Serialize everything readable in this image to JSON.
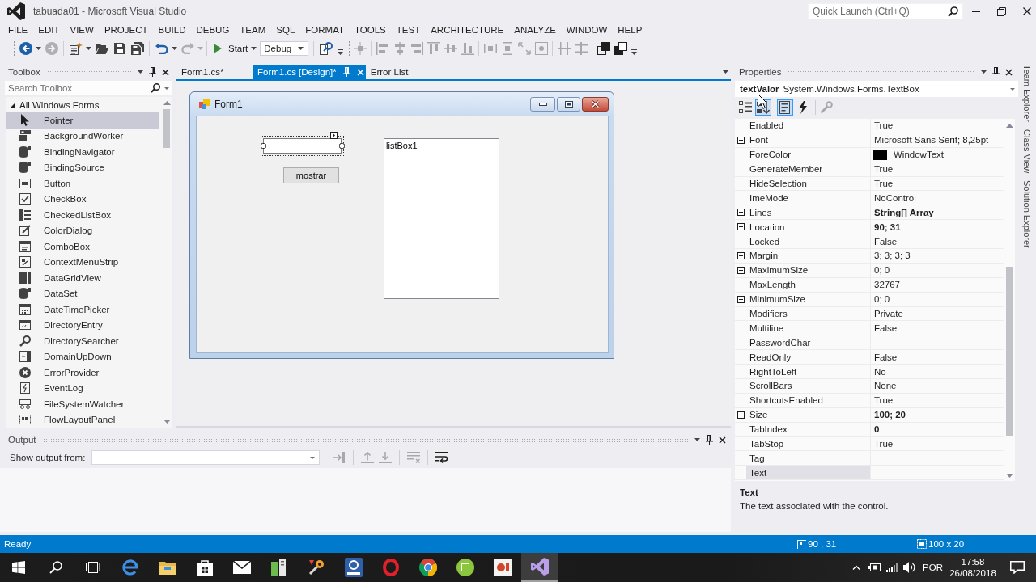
{
  "window": {
    "title": "tabuada01 - Microsoft Visual Studio",
    "quick_launch": {
      "placeholder": "Quick Launch (Ctrl+Q)"
    }
  },
  "menu": [
    "FILE",
    "EDIT",
    "VIEW",
    "PROJECT",
    "BUILD",
    "DEBUG",
    "TEAM",
    "SQL",
    "FORMAT",
    "TOOLS",
    "TEST",
    "ARCHITECTURE",
    "ANALYZE",
    "WINDOW",
    "HELP"
  ],
  "toolbars": [
    {
      "groups": [
        [
          {
            "kind": "split",
            "disabled": false
          },
          {
            "kind": "button",
            "disabled": true
          }
        ],
        [
          {
            "kind": "split",
            "disabled": false
          },
          {
            "kind": "button",
            "disabled": false
          },
          {
            "kind": "button",
            "disabled": false
          },
          {
            "kind": "button",
            "disabled": false
          }
        ],
        [
          {
            "kind": "split",
            "disabled": false
          },
          {
            "kind": "split",
            "disabled": true
          }
        ],
        [
          {
            "kind": "start",
            "label": "Start",
            "disabled": false
          },
          {
            "kind": "combo",
            "value": "Debug"
          }
        ],
        [
          {
            "kind": "button",
            "disabled": false
          }
        ]
      ]
    },
    {
      "groups": [
        [
          {
            "kind": "button",
            "disabled": true
          }
        ],
        [
          {
            "kind": "button",
            "disabled": true
          },
          {
            "kind": "button",
            "disabled": true
          },
          {
            "kind": "button",
            "disabled": true
          },
          {
            "kind": "button",
            "disabled": true
          },
          {
            "kind": "button",
            "disabled": true
          },
          {
            "kind": "button",
            "disabled": true
          }
        ],
        [
          {
            "kind": "button",
            "disabled": true
          },
          {
            "kind": "button",
            "disabled": true
          },
          {
            "kind": "button",
            "disabled": true
          },
          {
            "kind": "button",
            "disabled": true
          }
        ],
        [
          {
            "kind": "button",
            "disabled": true
          },
          {
            "kind": "button",
            "disabled": true
          }
        ],
        [
          {
            "kind": "button",
            "disabled": false
          },
          {
            "kind": "button",
            "disabled": false
          }
        ]
      ]
    }
  ],
  "toolbox": {
    "title": "Toolbox",
    "search": {
      "placeholder": "Search Toolbox"
    },
    "tree": [
      {
        "label": "All Windows Forms",
        "expanded": true,
        "children": [
          {
            "label": "Pointer",
            "selected": true
          },
          {
            "label": "BackgroundWorker",
            "selected": false
          },
          {
            "label": "BindingNavigator",
            "selected": false
          },
          {
            "label": "BindingSource",
            "selected": false
          },
          {
            "label": "Button",
            "selected": false
          },
          {
            "label": "CheckBox",
            "selected": false
          },
          {
            "label": "CheckedListBox",
            "selected": false
          },
          {
            "label": "ColorDialog",
            "selected": false
          },
          {
            "label": "ComboBox",
            "selected": false
          },
          {
            "label": "ContextMenuStrip",
            "selected": false
          },
          {
            "label": "DataGridView",
            "selected": false
          },
          {
            "label": "DataSet",
            "selected": false
          },
          {
            "label": "DateTimePicker",
            "selected": false
          },
          {
            "label": "DirectoryEntry",
            "selected": false
          },
          {
            "label": "DirectorySearcher",
            "selected": false
          },
          {
            "label": "DomainUpDown",
            "selected": false
          },
          {
            "label": "ErrorProvider",
            "selected": false
          },
          {
            "label": "EventLog",
            "selected": false
          },
          {
            "label": "FileSystemWatcher",
            "selected": false
          },
          {
            "label": "FlowLayoutPanel",
            "selected": false
          }
        ]
      }
    ]
  },
  "designer": {
    "tabs": [
      {
        "label": "Form1.cs*",
        "selected": false
      },
      {
        "label": "Form1.cs [Design]*",
        "selected": true
      },
      {
        "label": "Error List",
        "selected": false
      }
    ],
    "form": {
      "title": "Form1",
      "controls": [
        {
          "kind": "textbox",
          "selected": true
        },
        {
          "kind": "button",
          "label": "mostrar",
          "selected": false
        },
        {
          "kind": "listbox",
          "label": "listBox1",
          "selected": false
        }
      ]
    }
  },
  "output": {
    "title": "Output",
    "source_label": "Show output from:",
    "buttons": [
      [
        {
          "disabled": true
        }
      ],
      [
        {
          "disabled": true
        },
        {
          "disabled": true
        }
      ],
      [
        {
          "disabled": true
        }
      ],
      [
        {
          "disabled": false
        }
      ]
    ]
  },
  "properties": {
    "title": "Properties",
    "object_name": "textValor",
    "object_type": "System.Windows.Forms.TextBox",
    "buttons": [
      [
        {
          "selected": false,
          "disabled": false
        },
        {
          "selected": true,
          "disabled": false
        },
        {
          "selected": true,
          "disabled": false
        },
        {
          "selected": false,
          "disabled": false
        }
      ],
      [
        {
          "selected": false,
          "disabled": true
        }
      ]
    ],
    "rows": [
      {
        "name": "Enabled",
        "value": "True",
        "modified": false,
        "selected": false
      },
      {
        "name": "Font",
        "value": "Microsoft Sans Serif; 8,25pt",
        "expanded": false,
        "modified": false,
        "selected": false
      },
      {
        "name": "ForeColor",
        "value": "WindowText",
        "color": "#000000",
        "modified": false,
        "selected": false
      },
      {
        "name": "GenerateMember",
        "value": "True",
        "modified": false,
        "selected": false
      },
      {
        "name": "HideSelection",
        "value": "True",
        "modified": false,
        "selected": false
      },
      {
        "name": "ImeMode",
        "value": "NoControl",
        "modified": false,
        "selected": false
      },
      {
        "name": "Lines",
        "value": "String[] Array",
        "expanded": false,
        "modified": true,
        "selected": false
      },
      {
        "name": "Location",
        "value": "90; 31",
        "expanded": false,
        "modified": true,
        "selected": false
      },
      {
        "name": "Locked",
        "value": "False",
        "modified": false,
        "selected": false
      },
      {
        "name": "Margin",
        "value": "3; 3; 3; 3",
        "expanded": false,
        "modified": false,
        "selected": false
      },
      {
        "name": "MaximumSize",
        "value": "0; 0",
        "expanded": false,
        "modified": false,
        "selected": false
      },
      {
        "name": "MaxLength",
        "value": "32767",
        "modified": false,
        "selected": false
      },
      {
        "name": "MinimumSize",
        "value": "0; 0",
        "expanded": false,
        "modified": false,
        "selected": false
      },
      {
        "name": "Modifiers",
        "value": "Private",
        "modified": false,
        "selected": false
      },
      {
        "name": "Multiline",
        "value": "False",
        "modified": false,
        "selected": false
      },
      {
        "name": "PasswordChar",
        "selected": false
      },
      {
        "name": "ReadOnly",
        "value": "False",
        "modified": false,
        "selected": false
      },
      {
        "name": "RightToLeft",
        "value": "No",
        "modified": false,
        "selected": false
      },
      {
        "name": "ScrollBars",
        "value": "None",
        "modified": false,
        "selected": false
      },
      {
        "name": "ShortcutsEnabled",
        "value": "True",
        "modified": false,
        "selected": false
      },
      {
        "name": "Size",
        "value": "100; 20",
        "expanded": false,
        "modified": true,
        "selected": false
      },
      {
        "name": "TabIndex",
        "value": "0",
        "modified": true,
        "selected": false
      },
      {
        "name": "TabStop",
        "value": "True",
        "modified": false,
        "selected": false
      },
      {
        "name": "Tag",
        "selected": false
      },
      {
        "name": "Text",
        "selected": true
      }
    ],
    "description": {
      "title": "Text",
      "text": "The text associated with the control."
    }
  },
  "side_tabs": [
    "Team Explorer",
    "Class View",
    "Solution Explorer"
  ],
  "status_bar": {
    "text": "Ready",
    "position": "90 , 31",
    "size": "100 x 20"
  },
  "taskbar": {
    "buttons": [
      {
        "selected": false
      },
      {
        "selected": false
      },
      {
        "selected": false
      },
      {
        "selected": false
      },
      {
        "selected": false
      },
      {
        "selected": false
      },
      {
        "selected": false
      },
      {
        "selected": false
      },
      {
        "selected": false
      },
      {
        "selected": false
      },
      {
        "selected": false
      },
      {
        "selected": false
      },
      {
        "selected": false
      },
      {
        "selected": false
      },
      {
        "selected": true
      }
    ],
    "language": "POR",
    "time": "17:58",
    "date": "26/08/2018"
  }
}
